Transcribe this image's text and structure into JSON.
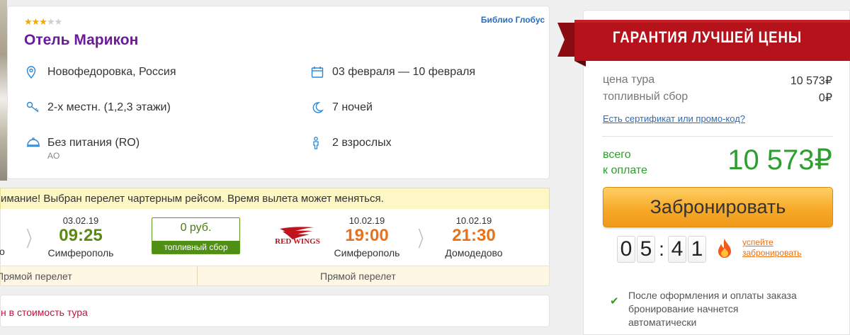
{
  "hotel": {
    "stars": 3,
    "stars_max": 5,
    "operator": "Библио Глобус",
    "name": "Отель Марикон",
    "location": "Новофедоровка, Россия",
    "dates": "03 февраля — 10 февраля",
    "room": "2-х местн. (1,2,3 этажи)",
    "nights": "7 ночей",
    "meal": "Без питания (RO)",
    "meal_code": "AO",
    "guests": "2 взрослых"
  },
  "flight": {
    "warning": "имание! Выбран перелет чартерным рейсом. Время вылета может меняться.",
    "outbound": {
      "date": "03.02.19",
      "time": "09:25",
      "city": "Симферополь",
      "origin_stub": "о",
      "type": "Прямой перелет"
    },
    "fuel": {
      "amount": "0 руб.",
      "label": "топливный сбор"
    },
    "airline": "RED WINGS",
    "return_departure": {
      "date": "10.02.19",
      "time": "19:00",
      "city": "Симферополь"
    },
    "return_arrival": {
      "date": "10.02.19",
      "time": "21:30",
      "city": "Домодедово"
    },
    "return_type": "Прямой перелет"
  },
  "included_text": "н в стоимость тура",
  "booking": {
    "guarantee": "ГАРАНТИЯ ЛУЧШЕЙ ЦЕНЫ",
    "tour_price_label": "цена тура",
    "tour_price_value": "10 573₽",
    "fuel_label": "топливный сбор",
    "fuel_value": "0₽",
    "promo_link": "Есть сертификат или промо-код?",
    "total_label_1": "всего",
    "total_label_2": "к оплате",
    "total_value": "10 573₽",
    "book_button": "Забронировать",
    "timer": {
      "m1": "0",
      "m2": "5",
      "s1": "4",
      "s2": "1"
    },
    "hurry_1": "успейте",
    "hurry_2": "забронировать",
    "note": "После оформления и оплаты заказа бронирование начнется автоматически"
  },
  "colors": {
    "hotel_name": "#6a1b9a",
    "accent_blue": "#2b86d6",
    "total_green": "#2e9e2e",
    "ribbon_red": "#b5121b",
    "button_orange": "#f7a928",
    "time_green": "#5a8a10",
    "time_orange": "#e8711a"
  },
  "icons": [
    "location-pin-icon",
    "calendar-icon",
    "bed-key-icon",
    "moon-icon",
    "meal-cloche-icon",
    "person-icon",
    "chevron-right-icon",
    "flame-icon",
    "check-icon"
  ]
}
